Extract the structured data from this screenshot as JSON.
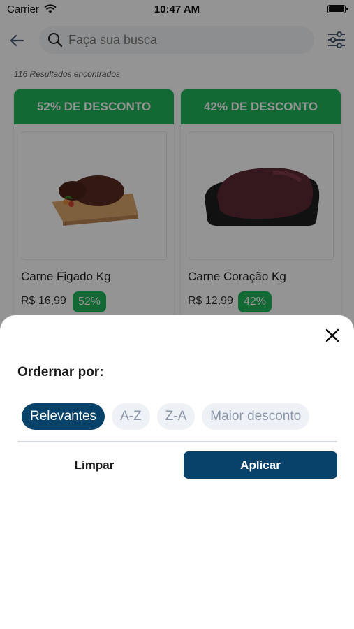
{
  "status_bar": {
    "carrier": "Carrier",
    "time": "10:47 AM",
    "battery_level": 0.95
  },
  "header": {
    "search_placeholder": "Faça sua busca",
    "back_icon": "arrow-left-icon",
    "filter_icon": "sliders-icon"
  },
  "results_text": "116 Resultados encontrados",
  "products": [
    {
      "discount_banner": "52% DE DESCONTO",
      "name": "Carne Figado Kg",
      "old_price": "R$ 16,99",
      "discount_badge": "52%"
    },
    {
      "discount_banner": "42% DE DESCONTO",
      "name": "Carne Coração Kg",
      "old_price": "R$ 12,99",
      "discount_badge": "42%"
    }
  ],
  "sort_sheet": {
    "title": "Ordernar por:",
    "options": [
      "Relevantes",
      "A-Z",
      "Z-A",
      "Maior desconto"
    ],
    "selected": "Relevantes",
    "clear_label": "Limpar",
    "apply_label": "Aplicar"
  },
  "colors": {
    "accent": "#06426a",
    "discount_green": "#1fb55a",
    "chip_bg": "#eef1f6"
  }
}
